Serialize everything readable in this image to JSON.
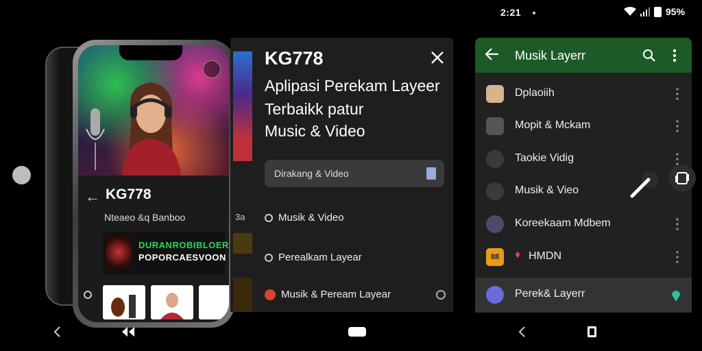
{
  "status": {
    "time": "2:21",
    "battery": "95%"
  },
  "phone": {
    "title": "KG778",
    "subtitle": "Nteaeo &q Banboo",
    "banner_line1": "DURANROBIBLOER",
    "banner_line2": "POPORCAESVOON"
  },
  "middle": {
    "title": "KG778",
    "subtitle_line1": "Aplipasi Perekam Layeer",
    "subtitle_line2": "Terbaikk patur",
    "subtitle_line3": "Music & Video",
    "search_placeholder": "Dirakang  & Video",
    "side_label": "3a",
    "options": [
      {
        "label": "Musik & Video"
      },
      {
        "label": "Perealkam Layear"
      },
      {
        "label": "Musik & Peream Layear"
      }
    ]
  },
  "app": {
    "title": "Musik Layerr",
    "items": [
      {
        "label": "Dplaoiih",
        "icon": "avatar-icon"
      },
      {
        "label": "Mopit & Mckam",
        "icon": "record-icon"
      },
      {
        "label": "Taokie Vidig",
        "icon": "camera-icon"
      },
      {
        "label": "Musik & Vieo",
        "icon": "music-icon"
      },
      {
        "label": "Koreekaam Mdbem",
        "icon": "star-icon"
      },
      {
        "label": "HMDN",
        "icon": "app-icon"
      },
      {
        "label": "Perek& Layerr",
        "icon": "user-icon"
      }
    ],
    "app_badge": "88"
  },
  "colors": {
    "accent_green": "#1c5a27",
    "record_red": "#d9442b"
  }
}
